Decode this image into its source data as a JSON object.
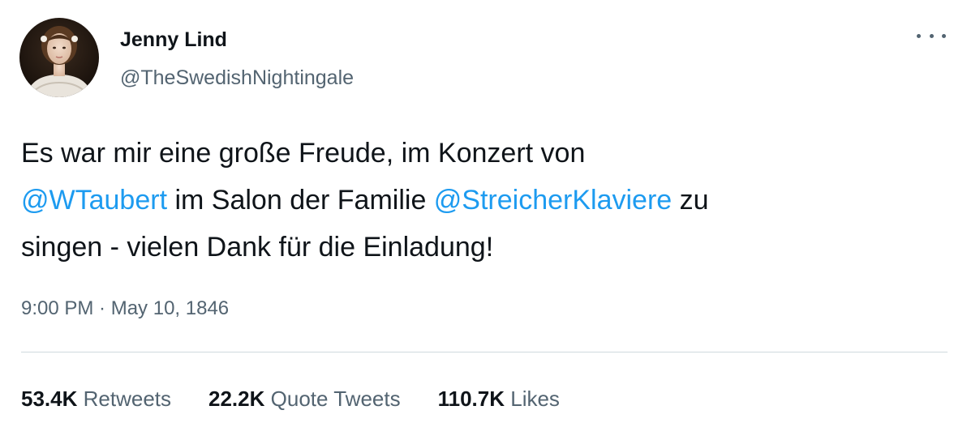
{
  "author": {
    "name": "Jenny Lind",
    "handle": "@TheSwedishNightingale",
    "avatar_icon": "portrait-avatar"
  },
  "tweet": {
    "line1": "Es war mir eine große Freude, im Konzert von",
    "mention1": "@WTaubert",
    "line2_mid": " im Salon der Familie ",
    "mention2": "@StreicherKlaviere",
    "line2_end": " zu",
    "line3": "singen - vielen Dank für die Einladung!"
  },
  "meta": {
    "time": "9:00 PM",
    "separator": " · ",
    "date": "May 10, 1846"
  },
  "stats": {
    "retweets_count": "53.4K",
    "retweets_label": "Retweets",
    "quotes_count": "22.2K",
    "quotes_label": "Quote Tweets",
    "likes_count": "110.7K",
    "likes_label": "Likes"
  },
  "colors": {
    "text": "#0f1419",
    "secondary": "#536471",
    "link": "#1d9bf0",
    "divider": "#cfd9de"
  }
}
